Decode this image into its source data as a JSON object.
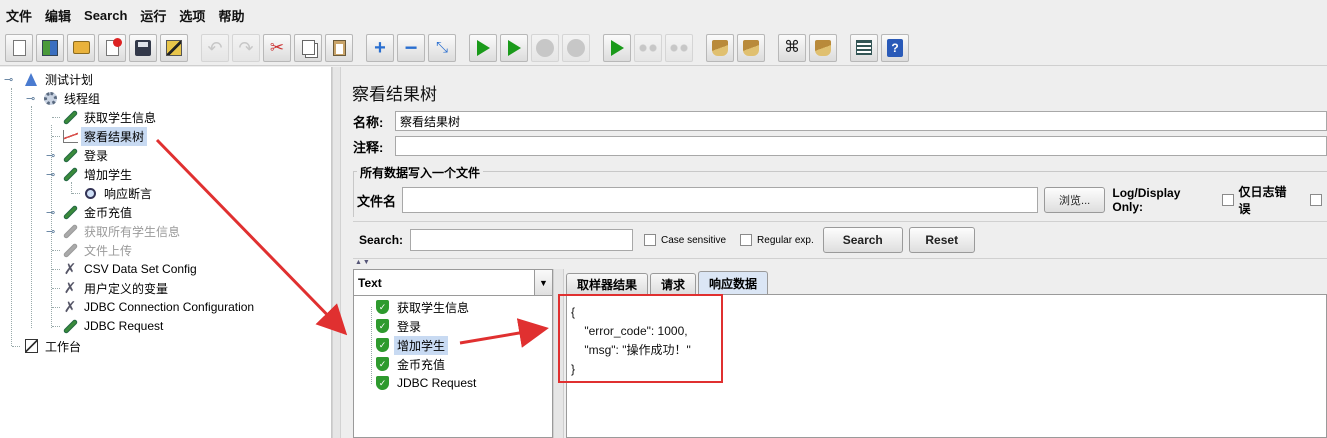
{
  "menu": [
    "文件",
    "编辑",
    "Search",
    "运行",
    "选项",
    "帮助"
  ],
  "toolbar": {
    "buttons": [
      "new-icon",
      "templates-icon",
      "open-icon",
      "close-icon",
      "save-icon",
      "save-as-icon",
      "undo-icon",
      "redo-icon",
      "cut-icon",
      "copy-icon",
      "paste-icon",
      "expand-icon",
      "collapse-icon",
      "toggle-icon",
      "start-icon",
      "start-no-pause-icon",
      "stop-icon",
      "shutdown-icon",
      "remote-start-icon",
      "remote-stop-icon",
      "remote-shutdown-icon",
      "clear-icon",
      "clear-all-icon",
      "search-icon",
      "reset-search-icon",
      "function-helper-icon",
      "help-icon"
    ]
  },
  "tree": {
    "root": "测试计划",
    "thread_group": "线程组",
    "children": [
      {
        "label": "获取学生信息",
        "type": "sampler",
        "disabled": false
      },
      {
        "label": "察看结果树",
        "type": "listener",
        "selected": true
      },
      {
        "label": "登录",
        "type": "sampler",
        "disabled": false
      },
      {
        "label": "增加学生",
        "type": "sampler",
        "disabled": false
      },
      {
        "label": "响应断言",
        "type": "assertion",
        "disabled": false
      },
      {
        "label": "金币充值",
        "type": "sampler",
        "disabled": false
      },
      {
        "label": "获取所有学生信息",
        "type": "sampler",
        "disabled": true
      },
      {
        "label": "文件上传",
        "type": "sampler",
        "disabled": true
      },
      {
        "label": "CSV Data Set Config",
        "type": "config"
      },
      {
        "label": "用户定义的变量",
        "type": "config"
      },
      {
        "label": "JDBC Connection Configuration",
        "type": "config"
      },
      {
        "label": "JDBC Request",
        "type": "sampler"
      }
    ],
    "workbench": "工作台"
  },
  "listener": {
    "title": "察看结果树",
    "name_label": "名称:",
    "name_value": "察看结果树",
    "comment_label": "注释:",
    "comment_value": "",
    "file_group_title": "所有数据写入一个文件",
    "filename_label": "文件名",
    "filename_value": "",
    "browse_label": "浏览...",
    "log_display_label": "Log/Display Only:",
    "errors_only_label": "仅日志错误"
  },
  "search": {
    "label": "Search:",
    "value": "",
    "case_sensitive": "Case sensitive",
    "regex": "Regular exp.",
    "search_button": "Search",
    "reset_button": "Reset"
  },
  "results": {
    "renderer": "Text",
    "items": [
      {
        "label": "获取学生信息",
        "status": "success"
      },
      {
        "label": "登录",
        "status": "success"
      },
      {
        "label": "增加学生",
        "status": "success",
        "selected": true
      },
      {
        "label": "金币充值",
        "status": "success"
      },
      {
        "label": "JDBC Request",
        "status": "success"
      }
    ]
  },
  "tabs": [
    {
      "label": "取样器结果",
      "active": false
    },
    {
      "label": "请求",
      "active": false
    },
    {
      "label": "响应数据",
      "active": true
    }
  ],
  "response": {
    "lines": [
      "{",
      "    \"error_code\": 1000,",
      "    \"msg\": \"操作成功！\"",
      "}"
    ]
  },
  "colors": {
    "annotation": "#e03030",
    "selection": "#c8daf2",
    "success": "#2e9a2e"
  }
}
